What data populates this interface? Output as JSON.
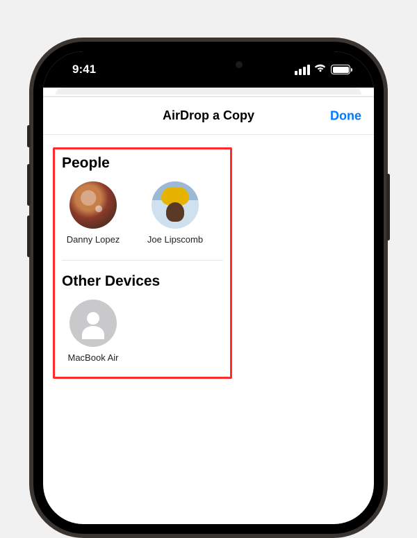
{
  "statusBar": {
    "time": "9:41"
  },
  "sheet": {
    "title": "AirDrop a Copy",
    "doneLabel": "Done"
  },
  "sections": {
    "peopleTitle": "People",
    "devicesTitle": "Other Devices"
  },
  "people": [
    {
      "name": "Danny Lopez"
    },
    {
      "name": "Joe Lipscomb"
    }
  ],
  "devices": [
    {
      "name": "MacBook Air"
    }
  ]
}
